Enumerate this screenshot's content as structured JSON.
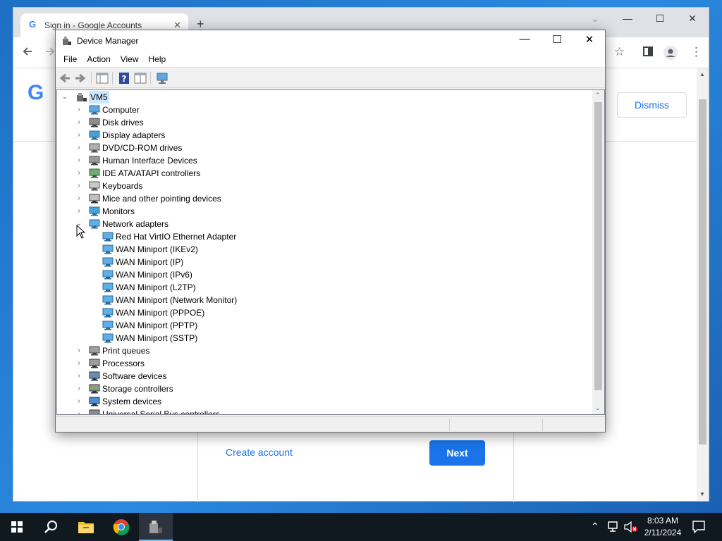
{
  "chrome": {
    "tab_title": "Sign in - Google Accounts",
    "tab_close": "✕",
    "new_tab": "+",
    "favicon_letter": "G",
    "logo_letter": "G",
    "dismiss_label": "Dismiss",
    "create_account_label": "Create account",
    "next_label": "Next",
    "window_controls": {
      "dropdown": "⌄",
      "minimize": "—",
      "maximize": "☐",
      "close": "✕"
    }
  },
  "device_manager": {
    "title": "Device Manager",
    "menu": [
      "File",
      "Action",
      "View",
      "Help"
    ],
    "window_controls": {
      "minimize": "—",
      "maximize": "☐",
      "close": "✕"
    },
    "tree": {
      "root": "VM5",
      "categories": [
        {
          "label": "Computer",
          "icon": "computer-icon",
          "expanded": false
        },
        {
          "label": "Disk drives",
          "icon": "disk-drive-icon",
          "expanded": false
        },
        {
          "label": "Display adapters",
          "icon": "display-adapter-icon",
          "expanded": false
        },
        {
          "label": "DVD/CD-ROM drives",
          "icon": "dvd-drive-icon",
          "expanded": false
        },
        {
          "label": "Human Interface Devices",
          "icon": "hid-icon",
          "expanded": false
        },
        {
          "label": "IDE ATA/ATAPI controllers",
          "icon": "ide-controller-icon",
          "expanded": false
        },
        {
          "label": "Keyboards",
          "icon": "keyboard-icon",
          "expanded": false
        },
        {
          "label": "Mice and other pointing devices",
          "icon": "mouse-icon",
          "expanded": false
        },
        {
          "label": "Monitors",
          "icon": "monitor-icon",
          "expanded": false
        },
        {
          "label": "Network adapters",
          "icon": "network-adapter-icon",
          "expanded": true,
          "children": [
            "Red Hat VirtIO Ethernet Adapter",
            "WAN Miniport (IKEv2)",
            "WAN Miniport (IP)",
            "WAN Miniport (IPv6)",
            "WAN Miniport (L2TP)",
            "WAN Miniport (Network Monitor)",
            "WAN Miniport (PPPOE)",
            "WAN Miniport (PPTP)",
            "WAN Miniport (SSTP)"
          ]
        },
        {
          "label": "Print queues",
          "icon": "printer-icon",
          "expanded": false
        },
        {
          "label": "Processors",
          "icon": "processor-icon",
          "expanded": false
        },
        {
          "label": "Software devices",
          "icon": "software-device-icon",
          "expanded": false
        },
        {
          "label": "Storage controllers",
          "icon": "storage-controller-icon",
          "expanded": false
        },
        {
          "label": "System devices",
          "icon": "system-device-icon",
          "expanded": false
        },
        {
          "label": "Universal Serial Bus controllers",
          "icon": "usb-icon",
          "expanded": false
        }
      ]
    }
  },
  "taskbar": {
    "time": "8:03 AM",
    "date": "2/11/2024"
  },
  "colors": {
    "google_blue": "#1a73e8",
    "selection": "#cce8ff",
    "taskbar": "#101820"
  }
}
